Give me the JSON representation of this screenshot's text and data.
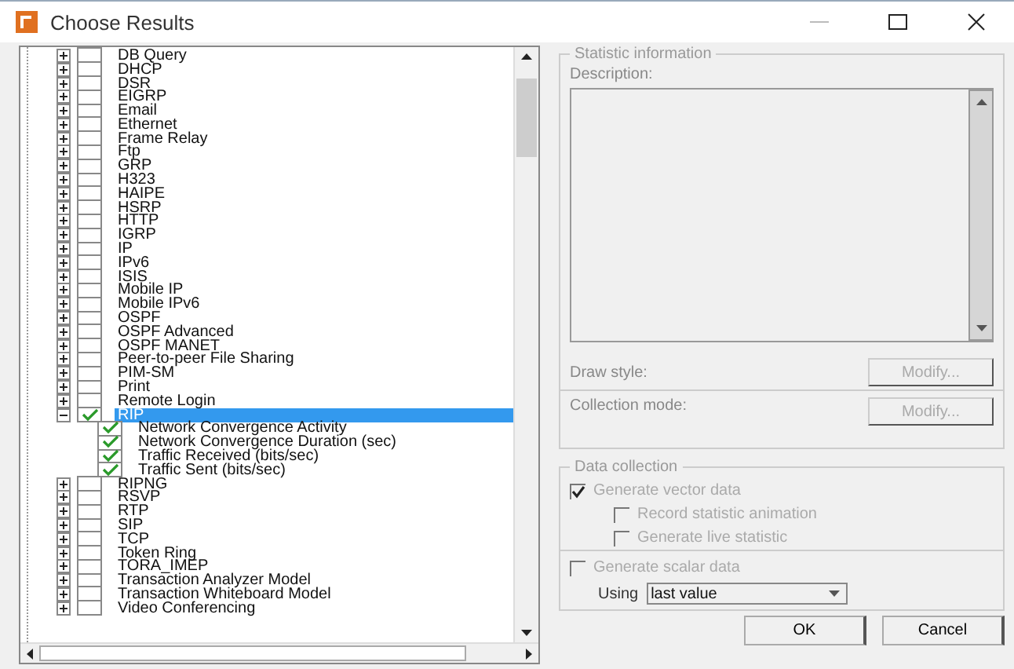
{
  "window": {
    "title": "Choose Results"
  },
  "tree": [
    {
      "label": "DB Query",
      "expanded": false,
      "checked": false,
      "selected": false
    },
    {
      "label": "DHCP",
      "expanded": false,
      "checked": false,
      "selected": false
    },
    {
      "label": "DSR",
      "expanded": false,
      "checked": false,
      "selected": false
    },
    {
      "label": "EIGRP",
      "expanded": false,
      "checked": false,
      "selected": false
    },
    {
      "label": "Email",
      "expanded": false,
      "checked": false,
      "selected": false
    },
    {
      "label": "Ethernet",
      "expanded": false,
      "checked": false,
      "selected": false
    },
    {
      "label": "Frame Relay",
      "expanded": false,
      "checked": false,
      "selected": false
    },
    {
      "label": "Ftp",
      "expanded": false,
      "checked": false,
      "selected": false
    },
    {
      "label": "GRP",
      "expanded": false,
      "checked": false,
      "selected": false
    },
    {
      "label": "H323",
      "expanded": false,
      "checked": false,
      "selected": false
    },
    {
      "label": "HAIPE",
      "expanded": false,
      "checked": false,
      "selected": false
    },
    {
      "label": "HSRP",
      "expanded": false,
      "checked": false,
      "selected": false
    },
    {
      "label": "HTTP",
      "expanded": false,
      "checked": false,
      "selected": false
    },
    {
      "label": "IGRP",
      "expanded": false,
      "checked": false,
      "selected": false
    },
    {
      "label": "IP",
      "expanded": false,
      "checked": false,
      "selected": false
    },
    {
      "label": "IPv6",
      "expanded": false,
      "checked": false,
      "selected": false
    },
    {
      "label": "ISIS",
      "expanded": false,
      "checked": false,
      "selected": false
    },
    {
      "label": "Mobile IP",
      "expanded": false,
      "checked": false,
      "selected": false
    },
    {
      "label": "Mobile IPv6",
      "expanded": false,
      "checked": false,
      "selected": false
    },
    {
      "label": "OSPF",
      "expanded": false,
      "checked": false,
      "selected": false
    },
    {
      "label": "OSPF Advanced",
      "expanded": false,
      "checked": false,
      "selected": false
    },
    {
      "label": "OSPF MANET",
      "expanded": false,
      "checked": false,
      "selected": false
    },
    {
      "label": "Peer-to-peer File Sharing",
      "expanded": false,
      "checked": false,
      "selected": false
    },
    {
      "label": "PIM-SM",
      "expanded": false,
      "checked": false,
      "selected": false
    },
    {
      "label": "Print",
      "expanded": false,
      "checked": false,
      "selected": false
    },
    {
      "label": "Remote Login",
      "expanded": false,
      "checked": false,
      "selected": false
    },
    {
      "label": "RIP",
      "expanded": true,
      "checked": true,
      "selected": true,
      "children": [
        {
          "label": "Network Convergence Activity",
          "checked": true,
          "selected": false
        },
        {
          "label": "Network Convergence Duration (sec)",
          "checked": true,
          "selected": false
        },
        {
          "label": "Traffic Received (bits/sec)",
          "checked": true,
          "selected": false
        },
        {
          "label": "Traffic Sent (bits/sec)",
          "checked": true,
          "selected": false
        }
      ]
    },
    {
      "label": "RIPNG",
      "expanded": false,
      "checked": false,
      "selected": false
    },
    {
      "label": "RSVP",
      "expanded": false,
      "checked": false,
      "selected": false
    },
    {
      "label": "RTP",
      "expanded": false,
      "checked": false,
      "selected": false
    },
    {
      "label": "SIP",
      "expanded": false,
      "checked": false,
      "selected": false
    },
    {
      "label": "TCP",
      "expanded": false,
      "checked": false,
      "selected": false
    },
    {
      "label": "Token Ring",
      "expanded": false,
      "checked": false,
      "selected": false
    },
    {
      "label": "TORA_IMEP",
      "expanded": false,
      "checked": false,
      "selected": false
    },
    {
      "label": "Transaction Analyzer Model",
      "expanded": false,
      "checked": false,
      "selected": false
    },
    {
      "label": "Transaction Whiteboard Model",
      "expanded": false,
      "checked": false,
      "selected": false
    },
    {
      "label": "Video Conferencing",
      "expanded": false,
      "checked": false,
      "selected": false
    }
  ],
  "statistic_information": {
    "title": "Statistic information",
    "description_label": "Description:",
    "draw_style": {
      "label": "Draw style:",
      "button": "Modify...",
      "disabled": true
    },
    "collection_mode": {
      "label": "Collection mode:",
      "button": "Modify...",
      "disabled": true
    }
  },
  "data_collection": {
    "title": "Data collection",
    "options": [
      {
        "label": "Generate vector data",
        "checked": true,
        "disabled": true,
        "nested": false
      },
      {
        "label": "Record statistic animation",
        "checked": false,
        "disabled": true,
        "nested": true
      },
      {
        "label": "Generate live statistic",
        "checked": false,
        "disabled": true,
        "nested": true
      }
    ],
    "scalar": {
      "label": "Generate scalar data",
      "checked": false,
      "disabled": true
    },
    "using_label": "Using",
    "using_value": "last value"
  },
  "buttons": [
    {
      "label": "OK"
    },
    {
      "label": "Cancel"
    }
  ]
}
